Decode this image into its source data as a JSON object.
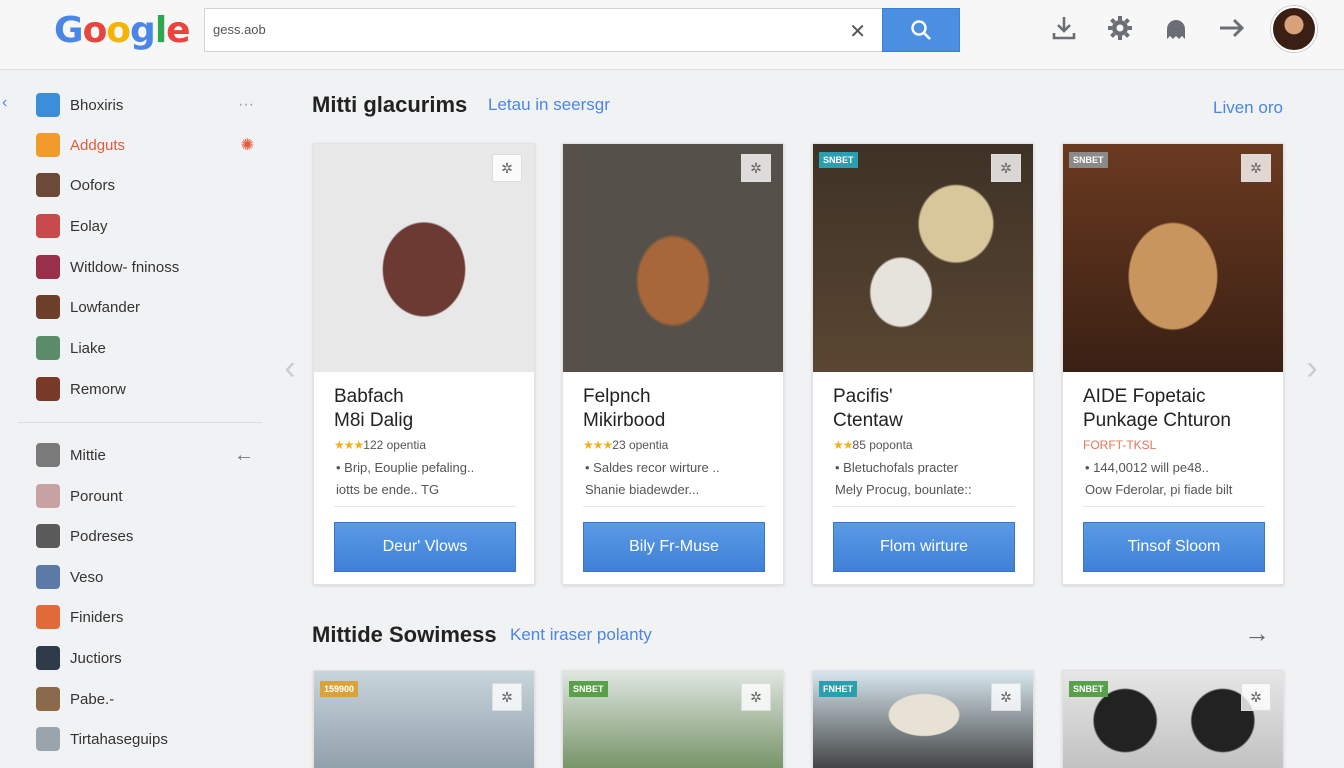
{
  "header": {
    "logo": [
      "G",
      "o",
      "o",
      "g",
      "l",
      "e"
    ],
    "search_value": "gess.aob",
    "icons": [
      "download-icon",
      "gear-icon",
      "user-icon",
      "arrow-right-icon"
    ]
  },
  "sidebar": {
    "group1": [
      {
        "label": "Bhoxiris",
        "icon": "inbox-icon",
        "color": "#3a8fd8"
      },
      {
        "label": "Addguts",
        "icon": "add-icon",
        "color": "#f39a2d"
      },
      {
        "label": "Oofors",
        "icon": "photo-icon",
        "color": "#6b4a3a"
      },
      {
        "label": "Eolay",
        "icon": "photo-icon",
        "color": "#c84a4a"
      },
      {
        "label": "Witldow- fninoss",
        "icon": "photo-icon",
        "color": "#9a2f4a"
      },
      {
        "label": "Lowfander",
        "icon": "photo-icon",
        "color": "#6e3f2a"
      },
      {
        "label": "Liake",
        "icon": "photo-icon",
        "color": "#5b8c6a"
      },
      {
        "label": "Remorw",
        "icon": "photo-icon",
        "color": "#7a3a2a"
      }
    ],
    "group2": [
      {
        "label": "Mittie",
        "icon": "photo-icon",
        "color": "#7a7a7a"
      },
      {
        "label": "Porount",
        "icon": "photo-icon",
        "color": "#c9a3a3"
      },
      {
        "label": "Podreses",
        "icon": "photo-icon",
        "color": "#5a5a5a"
      },
      {
        "label": "Veso",
        "icon": "photo-icon",
        "color": "#5b7aa8"
      },
      {
        "label": "Finiders",
        "icon": "photo-icon",
        "color": "#e06a3a"
      },
      {
        "label": "Juctiors",
        "icon": "photo-icon",
        "color": "#2f3a4a"
      },
      {
        "label": "Pabe.-",
        "icon": "photo-icon",
        "color": "#8a6a4a"
      },
      {
        "label": "Tirtahaseguips",
        "icon": "photo-icon",
        "color": "#9aa4ad"
      }
    ],
    "back_arrow": "←"
  },
  "section1": {
    "title": "Mitti glacurims",
    "subtitle": "Letau in seersgr",
    "link": "Liven oro",
    "cards": [
      {
        "title1": "Babfach",
        "title2": "M8i Dalig",
        "stars": "★★★",
        "rating": "122 opentia",
        "bullet1": "• Brip, Eouplie pefaling..",
        "bullet2": "iotts be ende.. TG",
        "button": "Deur' Vlows",
        "badge": "",
        "palette": "#c9c9c9"
      },
      {
        "title1": "Felpnch",
        "title2": "Mikirbood",
        "stars": "★★★",
        "rating": "23 opentia",
        "bullet1": "• Saldes recor wirture ..",
        "bullet2": "Shanie biadewder...",
        "button": "Bily Fr-Muse",
        "badge": "",
        "palette": "#5a5a55"
      },
      {
        "title1": "Pacifis'",
        "title2": "Ctentaw",
        "stars": "★★",
        "rating": "85 poponta",
        "bullet1": "• Bletuchofals practer",
        "bullet2": "Mely Procug, bounlate::",
        "button": "Flom wirture",
        "badge": "SNBET",
        "palette": "#4a3a2a"
      },
      {
        "title1": "AIDE Fopetaic",
        "title2": "Punkage Chturon",
        "stars": "",
        "rating": "FORFT-TKSL",
        "bullet1": "• 144,0012 will pe48..",
        "bullet2": "Oow Fderolar, pi fiade bilt",
        "button": "Tinsof Sloom",
        "badge": "SNBET",
        "palette": "#8a5a3a"
      }
    ]
  },
  "section2": {
    "title": "Mittide Sowimess",
    "subtitle": "Kent iraser polanty",
    "arrow": "→",
    "cards": [
      {
        "badge": "159900",
        "palette": "#8aa0ad"
      },
      {
        "badge": "SNBET",
        "palette": "#6a8a5a"
      },
      {
        "badge": "FNHET",
        "palette": "#bfd0dc"
      },
      {
        "badge": "SNBET",
        "palette": "#3a3a3a"
      }
    ]
  },
  "nav": {
    "prev": "‹",
    "next": "›"
  }
}
